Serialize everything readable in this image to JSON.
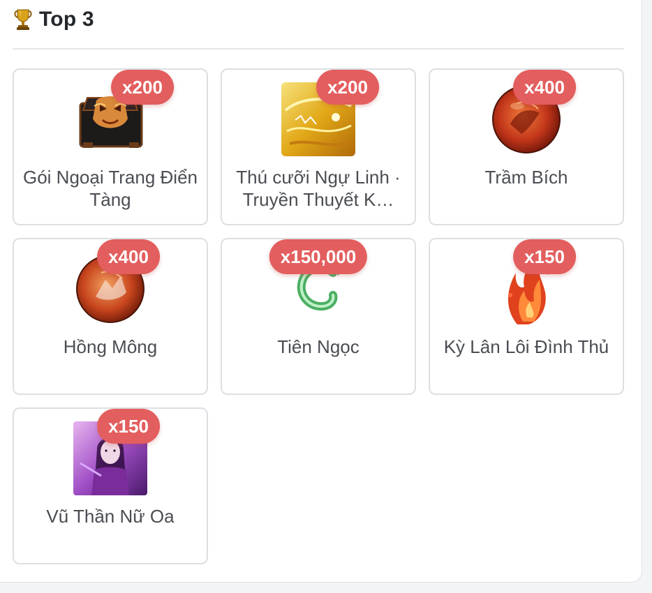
{
  "header": {
    "title": "Top 3",
    "icon": "trophy-icon"
  },
  "accent": "#e35e5e",
  "items": [
    {
      "name": "Gói Ngoại Trang Điển Tàng",
      "qty": "x200",
      "icon": "mask-chest-icon"
    },
    {
      "name": "Thú cưỡi Ngự Linh · Truyền Thuyết K…",
      "qty": "x200",
      "icon": "golden-mount-icon"
    },
    {
      "name": "Trầm Bích",
      "qty": "x400",
      "icon": "red-orb-icon"
    },
    {
      "name": "Hồng Mông",
      "qty": "x400",
      "icon": "red-orb-icon"
    },
    {
      "name": "Tiên Ngọc",
      "qty": "x150,000",
      "icon": "jade-dragon-icon"
    },
    {
      "name": "Kỳ Lân Lôi Đình Thủ",
      "qty": "x150",
      "icon": "fire-wing-icon"
    },
    {
      "name": "Vũ Thần Nữ Oa",
      "qty": "x150",
      "icon": "goddess-portrait-icon"
    }
  ]
}
